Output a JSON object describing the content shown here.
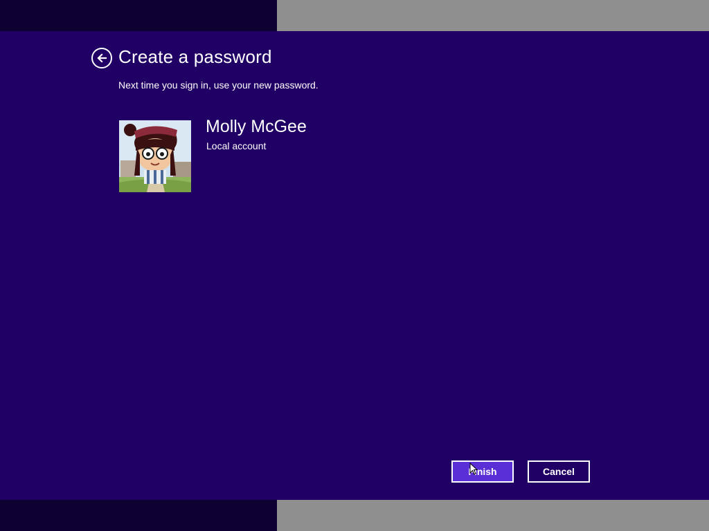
{
  "header": {
    "back_icon": "back-arrow-circle-icon",
    "title": "Create a password",
    "subtitle": "Next time you sign in, use your new password."
  },
  "account": {
    "name": "Molly McGee",
    "type": "Local account",
    "avatar": "cartoon-girl-avatar"
  },
  "buttons": {
    "finish_label": "Finish",
    "cancel_label": "Cancel"
  },
  "colors": {
    "background": "#200064",
    "accent_button": "#5a2fd6",
    "band_dark": "#0e0030",
    "band_gray": "#8f8f8f"
  }
}
